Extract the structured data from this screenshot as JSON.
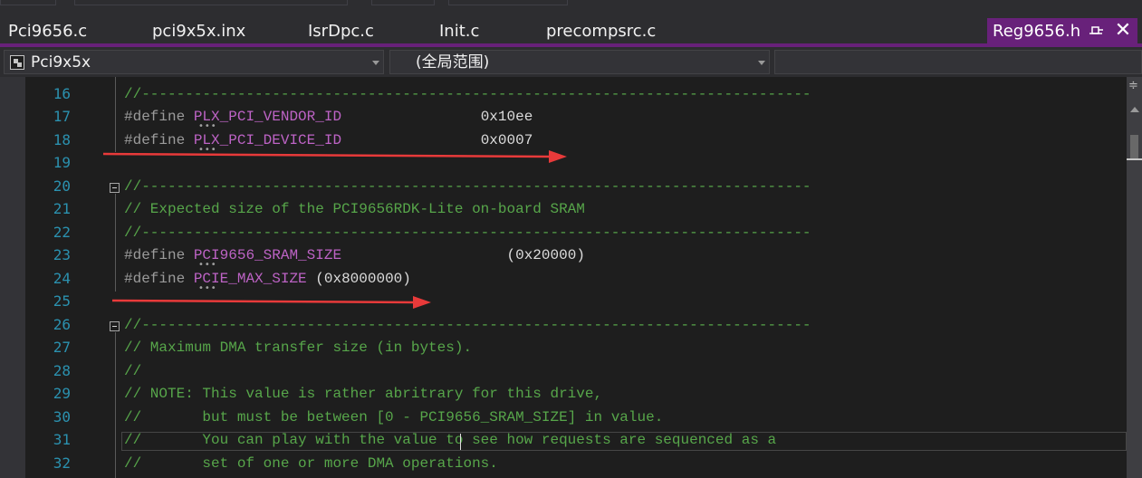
{
  "tabs": [
    {
      "label": "Pci9656.c"
    },
    {
      "label": "pci9x5x.inx"
    },
    {
      "label": "IsrDpc.c"
    },
    {
      "label": "Init.c"
    },
    {
      "label": "precompsrc.c"
    }
  ],
  "active_tab": {
    "label": "Reg9656.h",
    "pin_icon": "pin-icon",
    "close_icon": "close-icon"
  },
  "navbar": {
    "project_dropdown": "Pci9x5x",
    "scope_dropdown": "(全局范围)"
  },
  "editor": {
    "lines": [
      {
        "n": "16"
      },
      {
        "n": "17"
      },
      {
        "n": "18"
      },
      {
        "n": "19"
      },
      {
        "n": "20"
      },
      {
        "n": "21"
      },
      {
        "n": "22"
      },
      {
        "n": "23"
      },
      {
        "n": "24"
      },
      {
        "n": "25"
      },
      {
        "n": "26"
      },
      {
        "n": "27"
      },
      {
        "n": "28"
      },
      {
        "n": "29"
      },
      {
        "n": "30"
      },
      {
        "n": "31"
      },
      {
        "n": "32"
      }
    ],
    "code": {
      "l16": "//-----------------------------------------------------------------------------",
      "l17_kw": "#define",
      "l17_name": "PLX_PCI_VENDOR_ID",
      "l17_val": "0x10ee",
      "l18_kw": "#define",
      "l18_name": "PLX_PCI_DEVICE_ID",
      "l18_val": "0x0007",
      "l20": "//-----------------------------------------------------------------------------",
      "l21": "// Expected size of the PCI9656RDK-Lite on-board SRAM",
      "l22": "//-----------------------------------------------------------------------------",
      "l23_kw": "#define",
      "l23_name": "PCI9656_SRAM_SIZE",
      "l23_val": "(0x20000)",
      "l24_kw": "#define",
      "l24_name": "PCIE_MAX_SIZE",
      "l24_val": "(0x8000000)",
      "l26": "//-----------------------------------------------------------------------------",
      "l27": "// Maximum DMA transfer size (in bytes).",
      "l28": "//",
      "l29": "// NOTE: This value is rather abritrary for this drive,",
      "l30": "//       but must be between [0 - PCI9656_SRAM_SIZE] in value.",
      "l31": "//       You can play with the value to see how requests are sequenced as a",
      "l32": "//       set of one or more DMA operations."
    }
  },
  "colors": {
    "accent": "#68217a",
    "annotation_arrow": "#e83a3a",
    "comment": "#57a64a",
    "macro": "#bd63c5",
    "line_number": "#2b91af"
  }
}
